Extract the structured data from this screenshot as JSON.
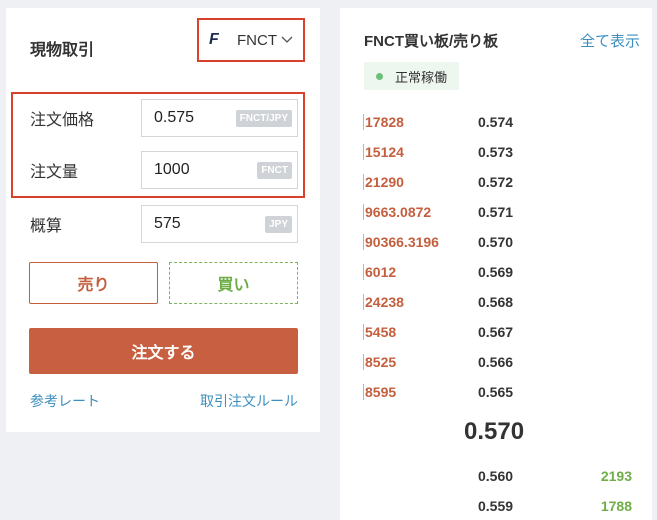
{
  "spot": {
    "title": "現物取引",
    "pair_icon_letter": "F",
    "pair": "FNCT",
    "chevron_icon": "chevron-down-icon",
    "price_label": "注文価格",
    "price_value": "0.575",
    "price_unit": "FNCT/JPY",
    "qty_label": "注文量",
    "qty_value": "1000",
    "qty_unit": "FNCT",
    "estimate_label": "概算",
    "estimate_value": "575",
    "estimate_unit": "JPY",
    "sell_label": "売り",
    "buy_label": "買い",
    "order_label": "注文する",
    "rate_link": "参考レート",
    "rules_link": "取引注文ルール"
  },
  "orderbook": {
    "title": "FNCT買い板/売り板",
    "show_all": "全て表示",
    "status": "正常稼働",
    "asks": [
      {
        "qty": "17828",
        "price": "0.574"
      },
      {
        "qty": "15124",
        "price": "0.573"
      },
      {
        "qty": "21290",
        "price": "0.572"
      },
      {
        "qty": "9663.0872",
        "price": "0.571"
      },
      {
        "qty": "90366.3196",
        "price": "0.570"
      },
      {
        "qty": "6012",
        "price": "0.569"
      },
      {
        "qty": "24238",
        "price": "0.568"
      },
      {
        "qty": "5458",
        "price": "0.567"
      },
      {
        "qty": "8525",
        "price": "0.566"
      },
      {
        "qty": "8595",
        "price": "0.565"
      }
    ],
    "mid_price": "0.570",
    "bids": [
      {
        "price": "0.560",
        "qty": "2193"
      },
      {
        "price": "0.559",
        "qty": "1788"
      }
    ]
  },
  "colors": {
    "accent_sell": "#c45f3e",
    "accent_buy": "#6fae47",
    "link": "#3c8fbf",
    "highlight": "#d9412b"
  }
}
